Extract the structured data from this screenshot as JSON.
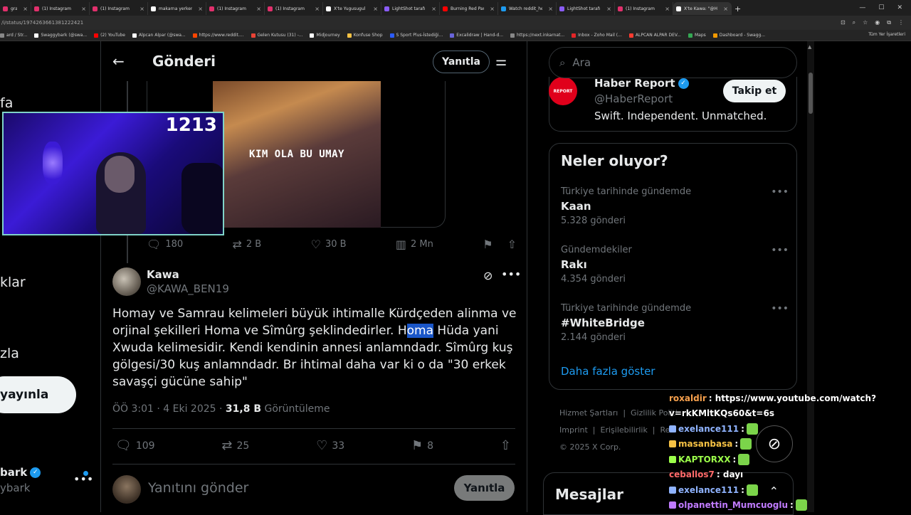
{
  "browser": {
    "tabs": [
      {
        "label": "gram",
        "color": "#e1306c"
      },
      {
        "label": "(1) Instagram",
        "color": "#e1306c"
      },
      {
        "label": "(1) Instagram",
        "color": "#e1306c"
      },
      {
        "label": "makarna yerken",
        "color": "#ffffff"
      },
      {
        "label": "(1) Instagram",
        "color": "#e1306c"
      },
      {
        "label": "(1) Instagram",
        "color": "#e1306c"
      },
      {
        "label": "X'te Yugusugul",
        "color": "#ffffff"
      },
      {
        "label": "LightShot tarafın",
        "color": "#8a5cf6"
      },
      {
        "label": "Burning Red Pari",
        "color": "#ff0000"
      },
      {
        "label": "Watch reddit_he",
        "color": "#1d9bf0"
      },
      {
        "label": "LightShot tarafın",
        "color": "#8a5cf6"
      },
      {
        "label": "(1) Instagram",
        "color": "#e1306c"
      },
      {
        "label": "X'te Kawa: \"@Ho",
        "color": "#ffffff"
      }
    ],
    "new_tab": "+",
    "url": "/i/status/1974263661381222421",
    "bookmarks": [
      {
        "label": "ard / Str...",
        "color": "#888888"
      },
      {
        "label": "Swaggybark (@swa...",
        "color": "#ffffff"
      },
      {
        "label": "(2) YouTube",
        "color": "#ff0000"
      },
      {
        "label": "Alpcan Alpar (@swa...",
        "color": "#ffffff"
      },
      {
        "label": "https://www.reddit....",
        "color": "#ff4500"
      },
      {
        "label": "Gelen Kutusu (31) -...",
        "color": "#ea4335"
      },
      {
        "label": "Midjourney",
        "color": "#ffffff"
      },
      {
        "label": "Konfuse Shop",
        "color": "#f6c244"
      },
      {
        "label": "S Sport Plus-İstediği...",
        "color": "#2b5cff"
      },
      {
        "label": "Excalidraw | Hand-d...",
        "color": "#6965db"
      },
      {
        "label": "https://next.inkarnat...",
        "color": "#888888"
      },
      {
        "label": "Inbox - Zoho Mail (...",
        "color": "#e42527"
      },
      {
        "label": "ALPCAN ALPAR DEV...",
        "color": "#ff3b30"
      },
      {
        "label": "Maps",
        "color": "#34a853"
      },
      {
        "label": "Dashboard - Swagg...",
        "color": "#f29900"
      }
    ],
    "bookmarks_right": "Tüm Yer İşaretleri"
  },
  "leftnav": {
    "items": [
      "fa",
      "klar",
      "zla"
    ],
    "post_label": "yayınla",
    "account_name": "bark",
    "account_handle": "ybark",
    "more": "•••"
  },
  "webcam": {
    "counter": "1213"
  },
  "header": {
    "title": "Gönderi",
    "reply_label": "Yanıtla"
  },
  "quoted": {
    "image_caption": "KIM OLA BU UMAY",
    "replies": "180",
    "reposts": "2 B",
    "likes": "30 B",
    "views": "2 Mn"
  },
  "post": {
    "author_name": "Kawa",
    "author_handle": "@KAWA_BEN19",
    "text_before": "Homay ve Samrau kelimeleri büyük ihtimalle Kürdçeden alinma ve orjinal şekilleri Homa ve Sîmûrg şeklindedirler. H",
    "text_highlight": "oma",
    "text_after": " Hüda yani Xwuda kelimesidir. Kendi kendinin annesi anlamndadr. Sîmûrg  kuş gölgesi/30 kuş anlamndadr. Br ihtimal daha var ki o da \"30 erkek savaşçi gücüne sahip\"",
    "time": "ÖÖ 3:01 · 4 Eki 2025 · ",
    "views_count": "31,8 B",
    "views_label": " Görüntüleme",
    "replies": "109",
    "reposts": "25",
    "likes": "33",
    "bookmarks": "8"
  },
  "reply_box": {
    "placeholder": "Yanıtını gönder",
    "button": "Yanıtla"
  },
  "right": {
    "search_placeholder": "Ara",
    "suggested": {
      "logo_text": "REPORT",
      "name": "Haber Report",
      "handle": "@HaberReport",
      "bio": "Swift. Independent. Unmatched.",
      "follow_label": "Takip et"
    },
    "trends_title": "Neler oluyor?",
    "trends": [
      {
        "context": "Türkiye tarihinde gündemde",
        "name": "Kaan",
        "count": "5.328 gönderi"
      },
      {
        "context": "Gündemdekiler",
        "name": "Rakı",
        "count": "4.354 gönderi"
      },
      {
        "context": "Türkiye tarihinde gündemde",
        "name": "#WhiteBridge",
        "count": "2.144 gönderi"
      }
    ],
    "show_more": "Daha fazla göster",
    "footer": {
      "l1a": "Hizmet Şartları",
      "l1b": "Gizlilik Politi",
      "l2a": "Imprint",
      "l2b": "Erişilebilirlik",
      "l2c": "Rekl",
      "l3": "© 2025 X Corp."
    },
    "messages_title": "Mesajlar"
  },
  "chat": [
    {
      "user": "roxaldir",
      "user_color": "#f6a04d",
      "msg": ": https://www.youtube.com/watch?"
    },
    {
      "user": "",
      "user_color": "#ffffff",
      "msg": "v=rkKMltKQs60&t=6s"
    },
    {
      "user": "exelance111",
      "user_color": "#8fb3ff",
      "msg": ":"
    },
    {
      "user": "masanbasa",
      "user_color": "#f6c244",
      "msg": ":"
    },
    {
      "user": "KAPTORXX",
      "user_color": "#9cff4a",
      "msg": ":"
    },
    {
      "user": "ceballos7",
      "user_color": "#ff6a6a",
      "msg": ": dayı"
    },
    {
      "user": "exelance111",
      "user_color": "#8fb3ff",
      "msg": ":"
    },
    {
      "user": "olpanettin_Mumcuoglu",
      "user_color": "#c07bff",
      "msg": ":"
    }
  ]
}
